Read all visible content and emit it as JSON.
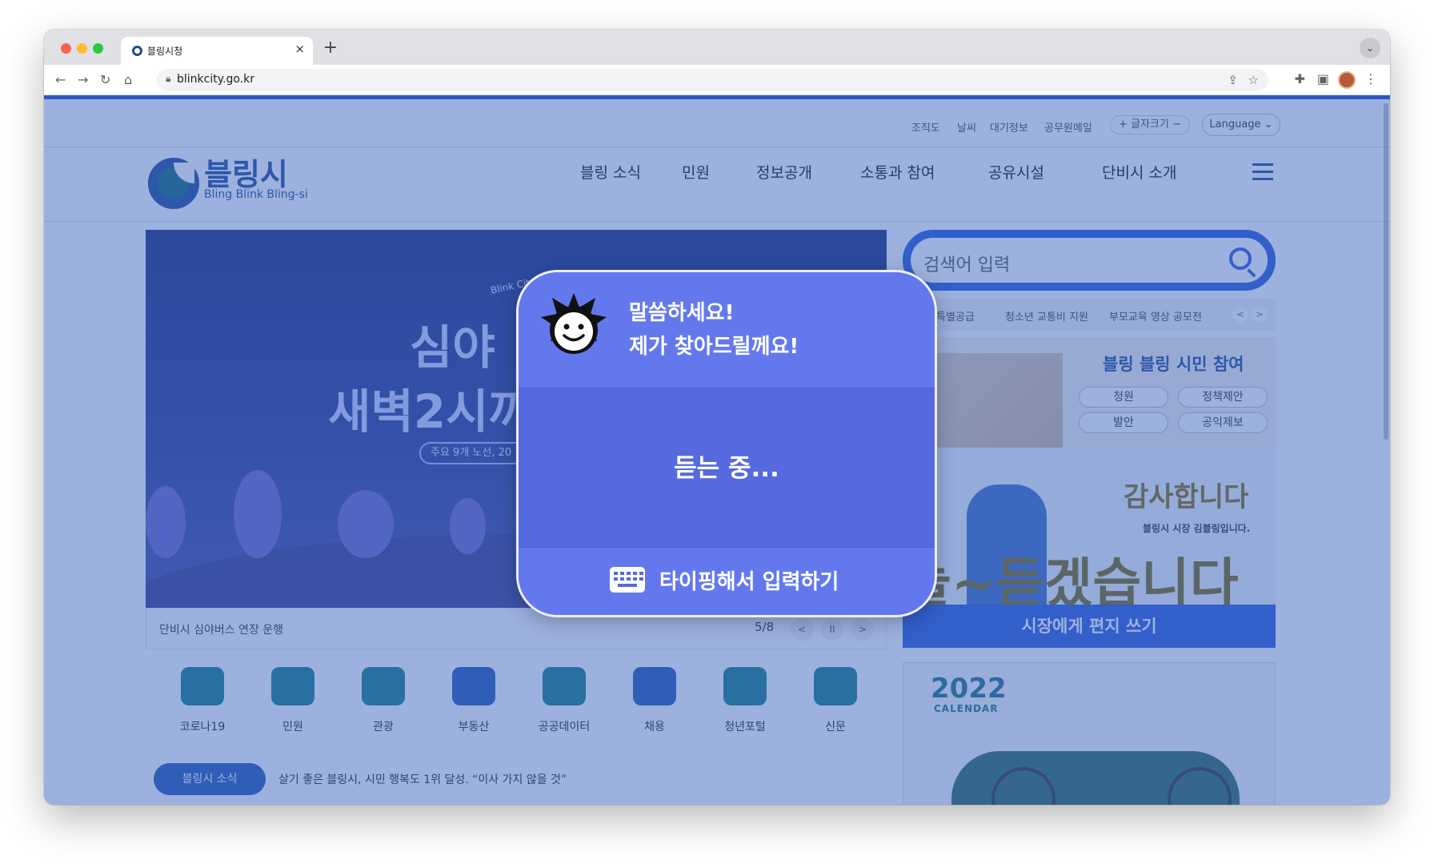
{
  "browser": {
    "tab_title": "블링시청",
    "url": "blinkcity.go.kr",
    "icons": [
      "back-arrow-icon",
      "forward-arrow-icon",
      "reload-icon",
      "home-icon",
      "lock-icon",
      "share-icon",
      "star-icon",
      "extensions-icon",
      "sidepanel-icon",
      "menu-dots-icon"
    ]
  },
  "utility_nav": {
    "items": [
      "조직도",
      "날씨",
      "대기정보",
      "공무원메일"
    ],
    "font_size_label": "글자크기",
    "font_plus": "+",
    "font_minus": "−",
    "language": "Language"
  },
  "header": {
    "logo_ko": "블링시",
    "logo_en": "Bling Blink Bling-si",
    "gnb": [
      "블링 소식",
      "민원",
      "정보공개",
      "소통과 참여",
      "공유시설",
      "단비시 소개"
    ]
  },
  "hero": {
    "sub": "Blink City Night B",
    "title1": "심야",
    "title2": "새벽2시까",
    "pill": "주요 9개 노선, 20",
    "caption": "단비시 심야버스 연장 운행",
    "page": "5/8",
    "prev": "<",
    "pause": "II",
    "next": ">"
  },
  "search": {
    "placeholder": "검색어 입력",
    "keywords": [
      "특별공급",
      "청소년 교통비 지원",
      "부모교육 영상 공모전"
    ],
    "prev": "<",
    "next": ">"
  },
  "civic": {
    "title": "블링 블링 시민 참여",
    "buttons": [
      "청원",
      "정책제안",
      "발안",
      "공익제보"
    ]
  },
  "mayor": {
    "title": "감사합니다",
    "sub": "블링시 시장 김블링입니다.",
    "big": "늘~듣겠습니다",
    "button": "시장에게 편지 쓰기"
  },
  "calendar": {
    "year": "2022",
    "label": "CALENDAR"
  },
  "quick_links": [
    "코로나19",
    "민원",
    "관광",
    "부동산",
    "공공데이터",
    "채용",
    "청년포털",
    "신문"
  ],
  "news": {
    "badge": "블링시 소식",
    "headline": "살기 좋은 블링시, 시민 행복도 1위 달성. “이사 가지 않을 것”"
  },
  "voice_dialog": {
    "prompt_line1": "말씀하세요!",
    "prompt_line2": "제가 찾아드릴께요!",
    "status": "듣는 중...",
    "type_button": "타이핑해서 입력하기"
  }
}
